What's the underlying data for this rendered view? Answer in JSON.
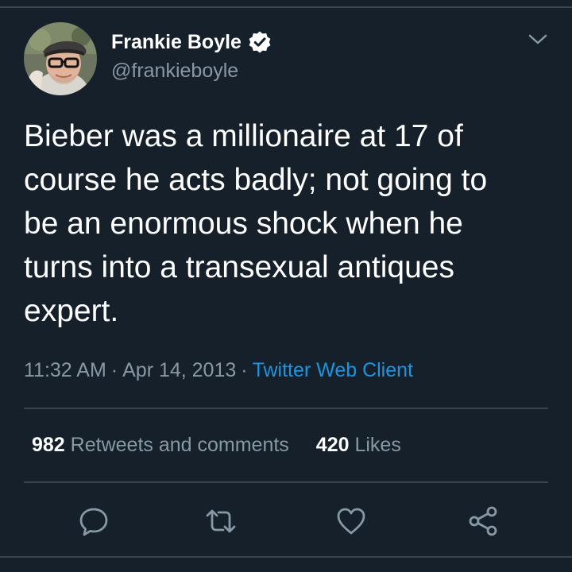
{
  "author": {
    "display_name": "Frankie Boyle",
    "handle": "@frankieboyle",
    "verified": true
  },
  "tweet": {
    "text_lines": [
      "Bieber was a millionaire at 17 of",
      "course he acts badly; not going to",
      "be an enormous shock when he",
      "turns into a transexual antiques",
      "expert."
    ],
    "time": "11:32 AM",
    "date": "Apr 14, 2013",
    "separator": "·",
    "source": "Twitter Web Client"
  },
  "stats": {
    "retweets_count": "982",
    "retweets_label": "Retweets and comments",
    "likes_count": "420",
    "likes_label": "Likes"
  },
  "icons": {
    "verified": "verified-badge-icon",
    "menu": "chevron-down-icon",
    "reply": "reply-icon",
    "retweet": "retweet-icon",
    "like": "heart-icon",
    "share": "share-icon"
  },
  "colors": {
    "background": "#15202b",
    "divider": "#38444d",
    "secondary_text": "#8899a6",
    "link": "#1b95e0",
    "primary_text": "#ffffff"
  }
}
